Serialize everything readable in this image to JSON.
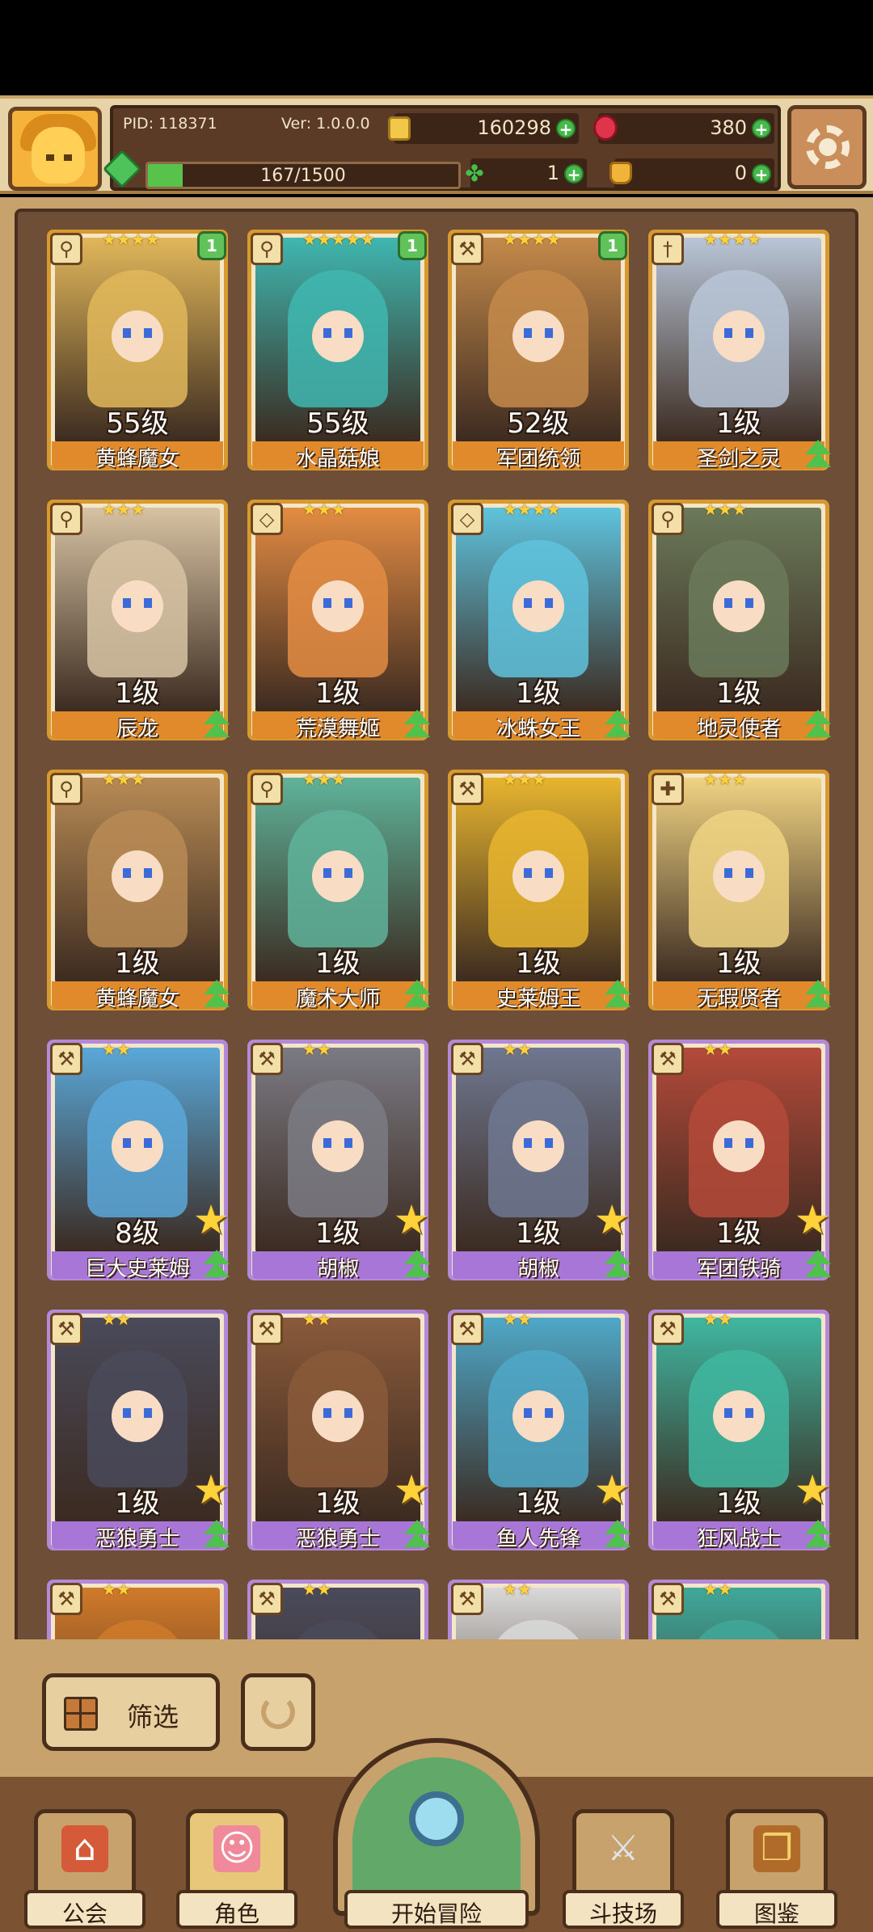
{
  "header": {
    "pid": "PID: 118371",
    "version": "Ver: 1.0.0.0",
    "gold": "160298",
    "rubies": "380",
    "exp_text": "167/1500",
    "exp_progress": 0.111,
    "clover": "1",
    "bag": "0"
  },
  "characters": [
    {
      "name": "黄蜂魔女",
      "level": "55级",
      "stars": "★★★★",
      "badge": "1",
      "rarity": "gold",
      "weapon": "staff-icon",
      "color": "#e1b75a"
    },
    {
      "name": "水晶菇娘",
      "level": "55级",
      "stars": "★★★★★",
      "badge": "1",
      "rarity": "gold",
      "weapon": "staff-icon",
      "color": "#3fb7b0"
    },
    {
      "name": "军团统领",
      "level": "52级",
      "stars": "★★★★",
      "badge": "1",
      "rarity": "gold",
      "weapon": "axe-icon",
      "color": "#c48a4a"
    },
    {
      "name": "圣剑之灵",
      "level": "1级",
      "stars": "★★★★",
      "badge": "",
      "rarity": "gold",
      "weapon": "sword-icon",
      "color": "#b9c6d7"
    },
    {
      "name": "辰龙",
      "level": "1级",
      "stars": "★★★",
      "badge": "",
      "rarity": "gold",
      "weapon": "staff-icon",
      "color": "#d7c3a3"
    },
    {
      "name": "荒漠舞姬",
      "level": "1级",
      "stars": "★★★",
      "badge": "",
      "rarity": "gold",
      "weapon": "dagger-icon",
      "color": "#e38c43"
    },
    {
      "name": "冰蛛女王",
      "level": "1级",
      "stars": "★★★★",
      "badge": "",
      "rarity": "gold",
      "weapon": "dagger-icon",
      "color": "#5fc3dd"
    },
    {
      "name": "地灵使者",
      "level": "1级",
      "stars": "★★★",
      "badge": "",
      "rarity": "gold",
      "weapon": "staff-icon",
      "color": "#6b7a5a"
    },
    {
      "name": "黄蜂魔女",
      "level": "1级",
      "stars": "★★★",
      "badge": "",
      "rarity": "gold",
      "weapon": "staff-icon",
      "color": "#b88b55"
    },
    {
      "name": "魔术大师",
      "level": "1级",
      "stars": "★★★",
      "badge": "",
      "rarity": "gold",
      "weapon": "staff-icon",
      "color": "#5fb39a"
    },
    {
      "name": "史莱姆王",
      "level": "1级",
      "stars": "★★★",
      "badge": "",
      "rarity": "gold",
      "weapon": "axe-icon",
      "color": "#e7b52f"
    },
    {
      "name": "无瑕贤者",
      "level": "1级",
      "stars": "★★★",
      "badge": "",
      "rarity": "gold",
      "weapon": "holy-icon",
      "color": "#f0d383"
    },
    {
      "name": "巨大史莱姆",
      "level": "8级",
      "stars": "★★",
      "badge": "",
      "rarity": "purple",
      "weapon": "axe-icon",
      "color": "#5aa8d9"
    },
    {
      "name": "胡椒",
      "level": "1级",
      "stars": "★★",
      "badge": "",
      "rarity": "purple",
      "weapon": "axe-icon",
      "color": "#7b7b84"
    },
    {
      "name": "胡椒",
      "level": "1级",
      "stars": "★★",
      "badge": "",
      "rarity": "purple",
      "weapon": "axe-icon",
      "color": "#6f7890"
    },
    {
      "name": "军团铁骑",
      "level": "1级",
      "stars": "★★",
      "badge": "",
      "rarity": "purple",
      "weapon": "axe-icon",
      "color": "#b44a3a"
    },
    {
      "name": "恶狼勇士",
      "level": "1级",
      "stars": "★★",
      "badge": "",
      "rarity": "purple",
      "weapon": "axe-icon",
      "color": "#4a4a5a"
    },
    {
      "name": "恶狼勇士",
      "level": "1级",
      "stars": "★★",
      "badge": "",
      "rarity": "purple",
      "weapon": "axe-icon",
      "color": "#8a5a3a"
    },
    {
      "name": "鱼人先锋",
      "level": "1级",
      "stars": "★★",
      "badge": "",
      "rarity": "purple",
      "weapon": "axe-icon",
      "color": "#4fa8c8"
    },
    {
      "name": "狂风战士",
      "level": "1级",
      "stars": "★★",
      "badge": "",
      "rarity": "purple",
      "weapon": "axe-icon",
      "color": "#3fb7a0"
    },
    {
      "name": "",
      "level": "",
      "stars": "★★",
      "badge": "",
      "rarity": "purple",
      "weapon": "axe-icon",
      "color": "#d07a2a"
    },
    {
      "name": "",
      "level": "",
      "stars": "★★",
      "badge": "",
      "rarity": "purple",
      "weapon": "axe-icon",
      "color": "#4a4a5a"
    },
    {
      "name": "",
      "level": "",
      "stars": "★★",
      "badge": "",
      "rarity": "purple",
      "weapon": "axe-icon",
      "color": "#d9d9d9"
    },
    {
      "name": "",
      "level": "",
      "stars": "★★",
      "badge": "",
      "rarity": "purple",
      "weapon": "axe-icon",
      "color": "#3fa89a"
    }
  ],
  "controls": {
    "filter_label": "筛选"
  },
  "nav": {
    "guild": "公会",
    "role": "角色",
    "adventure": "开始冒险",
    "arena": "斗技场",
    "codex": "图鉴"
  }
}
